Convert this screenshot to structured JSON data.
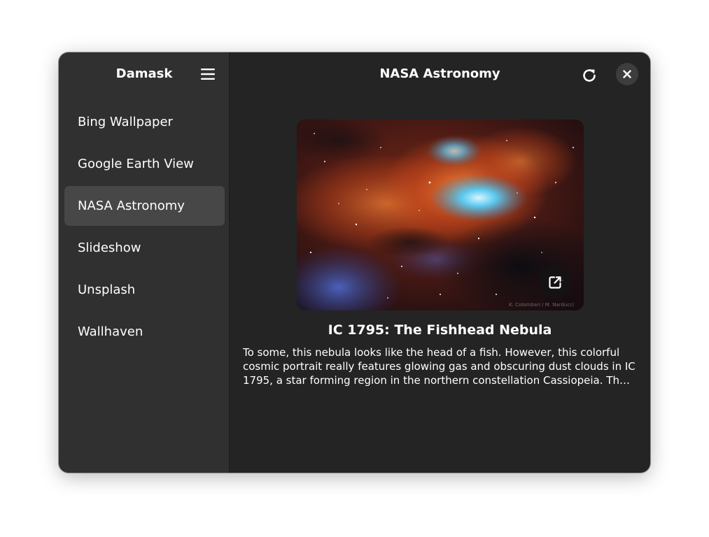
{
  "window": {
    "sidebar": {
      "title": "Damask",
      "menu_icon": "hamburger-menu-icon",
      "items": [
        {
          "label": "Bing Wallpaper",
          "active": false
        },
        {
          "label": "Google Earth View",
          "active": false
        },
        {
          "label": "NASA Astronomy",
          "active": true
        },
        {
          "label": "Slideshow",
          "active": false
        },
        {
          "label": "Unsplash",
          "active": false
        },
        {
          "label": "Wallhaven",
          "active": false
        }
      ]
    },
    "content": {
      "title": "NASA Astronomy",
      "refresh_icon": "refresh-icon",
      "close_icon": "close-icon",
      "image": {
        "credit": "K. Colombari / M. Narducci",
        "open_icon": "open-external-icon"
      },
      "image_title": "IC 1795: The Fishhead Nebula",
      "description": "To some, this nebula looks like the head of a fish. However, this colorful cosmic portrait really features glowing gas and obscuring dust clouds in IC 1795, a star forming region in the northern constellation Cassiopeia. The nebula's colors were created by adopting the Hubble false-color palette for mapping narrowband emissions."
    }
  },
  "colors": {
    "window_bg": "#242424",
    "sidebar_bg": "#303030",
    "active_item_bg": "#474747",
    "text": "#ffffff"
  }
}
